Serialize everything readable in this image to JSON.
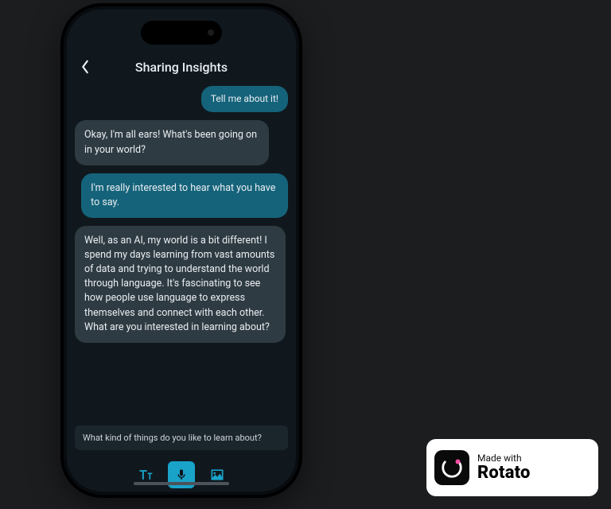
{
  "header": {
    "title": "Sharing Insights"
  },
  "messages": {
    "m0": "Tell me about it!",
    "m1": "Okay, I'm all ears! What's been going on in your world?",
    "m2": "I'm really interested to hear what you have to say.",
    "m3": "Well, as an AI, my world is a bit different! I spend my days learning from vast amounts of data and trying to understand the world through language. It's fascinating to see how people use language to express themselves and connect with each other. What are you interested in learning about?"
  },
  "suggestion": "What kind of things do you like to learn about?",
  "badge": {
    "made_with": "Made with",
    "name": "Rotato"
  },
  "colors": {
    "user_bubble": "#15637a",
    "ai_bubble": "#2f3b42",
    "accent": "#1aa3c9"
  }
}
